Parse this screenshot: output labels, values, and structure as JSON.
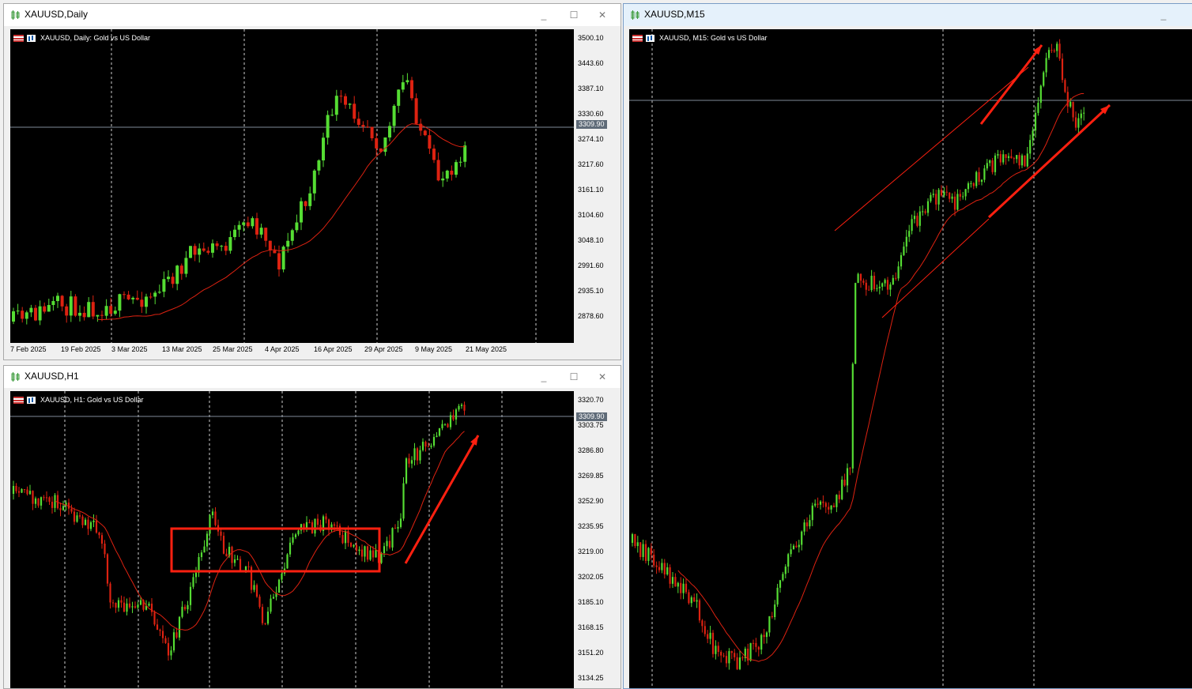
{
  "windows": {
    "daily": {
      "title": "XAUUSD,Daily",
      "label": "XAUUSD, Daily:  Gold vs US Dollar",
      "current_price": "3309.90",
      "y_axis": [
        "3500.10",
        "3443.60",
        "3387.10",
        "3330.60",
        "3274.10",
        "3217.60",
        "3161.10",
        "3104.60",
        "3048.10",
        "2991.60",
        "2935.10",
        "2878.60"
      ],
      "x_axis": [
        "7 Feb 2025",
        "19 Feb 2025",
        "3 Mar 2025",
        "13 Mar 2025",
        "25 Mar 2025",
        "4 Apr 2025",
        "16 Apr 2025",
        "29 Apr 2025",
        "9 May 2025",
        "21 May 2025"
      ]
    },
    "h1": {
      "title": "XAUUSD,H1",
      "label": "XAUUSD, H1:  Gold vs US Dollar",
      "current_price": "3309.90",
      "y_axis": [
        "3320.70",
        "3303.75",
        "3286.80",
        "3269.85",
        "3252.90",
        "3235.95",
        "3219.00",
        "3202.05",
        "3185.10",
        "3168.15",
        "3151.20",
        "3134.25"
      ]
    },
    "m15": {
      "title": "XAUUSD,M15",
      "label": "XAUUSD, M15:  Gold vs US Dollar"
    }
  },
  "colors": {
    "up": "#55dd33",
    "down": "#dd2211",
    "ma": "#dd2211",
    "annotation": "#ff2010",
    "grid": "#cccccc",
    "bid": "#7f8a99"
  },
  "controls": {
    "minimize": "_",
    "maximize": "☐",
    "close": "✕"
  }
}
